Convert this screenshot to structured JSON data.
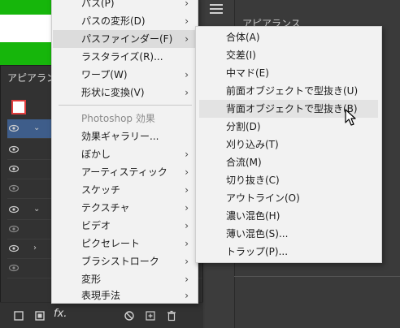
{
  "background": {
    "appearance_panel_title": "アピアランス",
    "right_panel_title": "アピアランス"
  },
  "main_menu": {
    "items": [
      {
        "label": "パス(P)",
        "arrow": "›"
      },
      {
        "label": "パスの変形(D)",
        "arrow": "›"
      },
      {
        "label": "パスファインダー(F)",
        "arrow": "›",
        "active": true
      },
      {
        "label": "ラスタライズ(R)...",
        "arrow": ""
      },
      {
        "label": "ワープ(W)",
        "arrow": "›"
      },
      {
        "label": "形状に変換(V)",
        "arrow": "›"
      },
      {
        "label": "Photoshop 効果",
        "arrow": "",
        "section": true
      },
      {
        "label": "効果ギャラリー...",
        "arrow": ""
      },
      {
        "label": "ぼかし",
        "arrow": "›"
      },
      {
        "label": "アーティスティック",
        "arrow": "›"
      },
      {
        "label": "スケッチ",
        "arrow": "›"
      },
      {
        "label": "テクスチャ",
        "arrow": "›"
      },
      {
        "label": "ビデオ",
        "arrow": "›"
      },
      {
        "label": "ピクセレート",
        "arrow": "›"
      },
      {
        "label": "ブラシストローク",
        "arrow": "›"
      },
      {
        "label": "変形",
        "arrow": "›"
      },
      {
        "label": "表現手法",
        "arrow": "›"
      }
    ]
  },
  "sub_menu": {
    "items": [
      {
        "label": "合体(A)"
      },
      {
        "label": "交差(I)"
      },
      {
        "label": "中マド(E)"
      },
      {
        "label": "前面オブジェクトで型抜き(U)"
      },
      {
        "label": "背面オブジェクトで型抜き(B)",
        "hover": true
      },
      {
        "label": "分割(D)"
      },
      {
        "label": "刈り込み(T)"
      },
      {
        "label": "合流(M)"
      },
      {
        "label": "切り抜き(C)"
      },
      {
        "label": "アウトライン(O)"
      },
      {
        "label": "濃い混色(H)"
      },
      {
        "label": "薄い混色(S)..."
      },
      {
        "label": "トラップ(P)..."
      }
    ]
  },
  "bottom_bar": {
    "fx_label": "fx."
  },
  "colors": {
    "menu_bg": "#f2f2f2",
    "active_item": "#dcdcdc",
    "hover_item": "#e3e3e3",
    "green": "#16b60b",
    "selected_row": "#3e5d8a"
  }
}
